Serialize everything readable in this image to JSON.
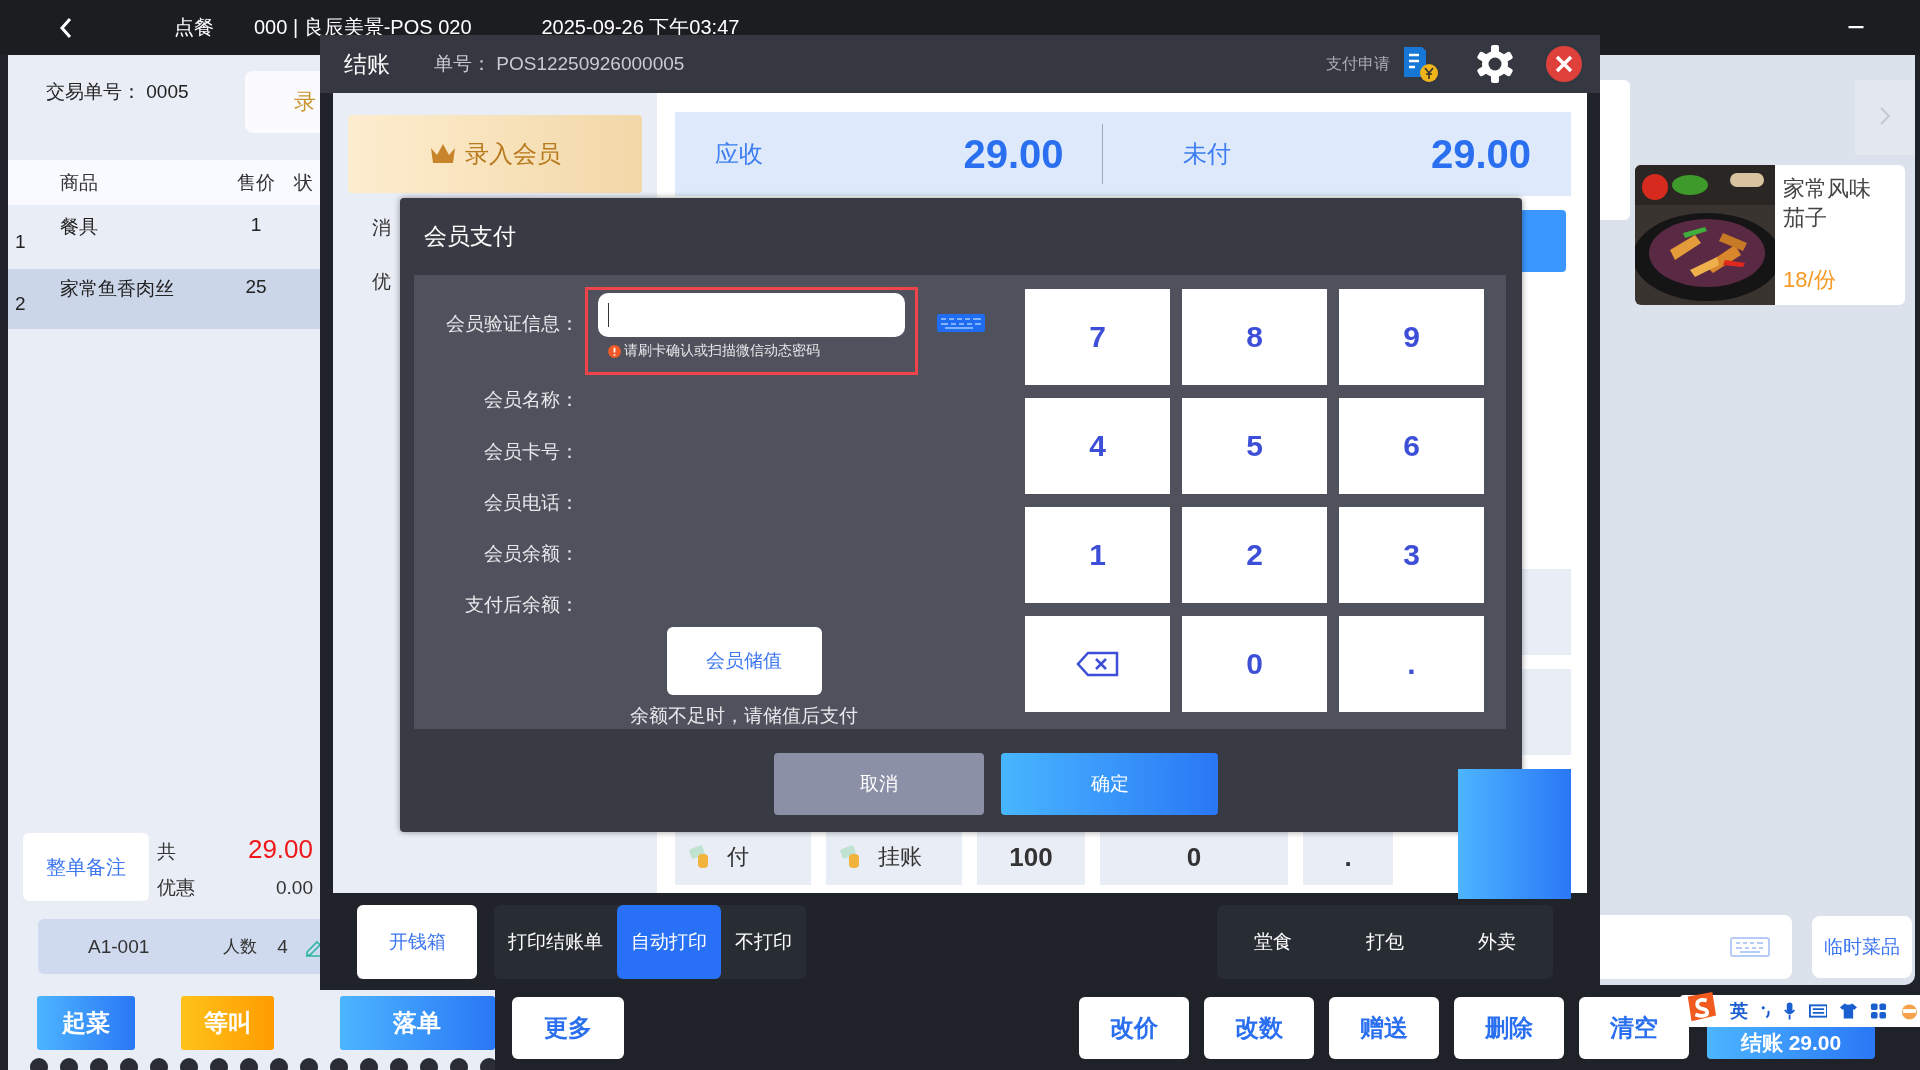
{
  "top_bar": {
    "title": "点餐",
    "device": "000 | 良辰美景-POS 020",
    "datetime": "2025-09-26 下午03:47"
  },
  "order": {
    "trade_no_label": "交易单号：",
    "trade_no": "0005",
    "side_button": "录",
    "columns": [
      "商品",
      "售价",
      "状"
    ],
    "rows": [
      {
        "index": "1",
        "name": "餐具",
        "price": "1",
        "selected": false
      },
      {
        "index": "2",
        "name": "家常鱼香肉丝",
        "price": "25",
        "selected": true
      }
    ],
    "note_button": "整单备注",
    "total_label": "共",
    "total": "29.00",
    "discount_label": "优惠",
    "discount": "0.00",
    "table": "A1-001",
    "guests_label": "人数",
    "guests": "4",
    "actions": [
      {
        "label": "起菜",
        "kind": "blue"
      },
      {
        "label": "等叫",
        "kind": "orange"
      },
      {
        "label": "落单",
        "kind": "blue"
      }
    ]
  },
  "menu": {
    "dishes": [
      {
        "name": "家常风味茄子",
        "price": "18/份"
      }
    ],
    "temp_dish_button": "临时菜品"
  },
  "bottom_actions": {
    "more": "更多",
    "buttons": [
      "改价",
      "改数",
      "赠送",
      "删除",
      "清空"
    ],
    "checkout": "结账 29.00"
  },
  "ime_toolbar": {
    "lang": "英"
  },
  "checkout": {
    "title": "结账",
    "order_no_label": "单号：",
    "order_no": "POS12250926000005",
    "pay_request": "支付申请",
    "member_button": "录入会员",
    "left_labels": [
      "消",
      "优"
    ],
    "receivable_label": "应收",
    "receivable": "29.00",
    "unpaid_label": "未付",
    "unpaid": "29.00",
    "pay_methods": [
      {
        "label": "付"
      },
      {
        "label": "挂账"
      }
    ],
    "quick_keys": [
      "100",
      "0",
      "."
    ],
    "cash_drawer": "开钱箱",
    "print_options": [
      {
        "label": "打印结账单",
        "selected": false
      },
      {
        "label": "自动打印",
        "selected": true
      },
      {
        "label": "不打印",
        "selected": false
      }
    ],
    "dining_modes": [
      {
        "label": "堂食",
        "selected": false
      },
      {
        "label": "打包",
        "selected": false
      },
      {
        "label": "外卖",
        "selected": false
      }
    ]
  },
  "member_pay": {
    "title": "会员支付",
    "verify_label": "会员验证信息：",
    "hint": "请刷卡确认或扫描微信动态密码",
    "fields": [
      "会员名称：",
      "会员卡号：",
      "会员电话：",
      "会员余额：",
      "支付后余额："
    ],
    "recharge_button": "会员储值",
    "recharge_note": "余额不足时，请储值后支付",
    "keys": [
      {
        "kind": "digit",
        "label": "7"
      },
      {
        "kind": "digit",
        "label": "8"
      },
      {
        "kind": "digit",
        "label": "9"
      },
      {
        "kind": "digit",
        "label": "4"
      },
      {
        "kind": "digit",
        "label": "5"
      },
      {
        "kind": "digit",
        "label": "6"
      },
      {
        "kind": "digit",
        "label": "1"
      },
      {
        "kind": "digit",
        "label": "2"
      },
      {
        "kind": "digit",
        "label": "3"
      },
      {
        "kind": "backspace"
      },
      {
        "kind": "digit",
        "label": "0"
      },
      {
        "kind": "digit",
        "label": "."
      }
    ],
    "cancel": "取消",
    "confirm": "确定"
  }
}
